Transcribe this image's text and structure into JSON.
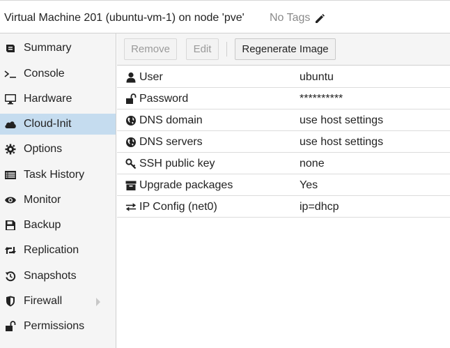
{
  "header": {
    "title": "Virtual Machine 201 (ubuntu-vm-1) on node 'pve'",
    "tags": "No Tags"
  },
  "sidebar": {
    "items": [
      {
        "label": "Summary",
        "icon": "summary-icon"
      },
      {
        "label": "Console",
        "icon": "console-icon"
      },
      {
        "label": "Hardware",
        "icon": "monitor-icon"
      },
      {
        "label": "Cloud-Init",
        "icon": "cloud-icon",
        "active": true
      },
      {
        "label": "Options",
        "icon": "gear-icon"
      },
      {
        "label": "Task History",
        "icon": "list-icon"
      },
      {
        "label": "Monitor",
        "icon": "eye-icon"
      },
      {
        "label": "Backup",
        "icon": "floppy-icon"
      },
      {
        "label": "Replication",
        "icon": "retweet-icon"
      },
      {
        "label": "Snapshots",
        "icon": "history-icon"
      },
      {
        "label": "Firewall",
        "icon": "shield-icon",
        "expandable": true
      },
      {
        "label": "Permissions",
        "icon": "unlock-icon"
      }
    ]
  },
  "toolbar": {
    "remove_label": "Remove",
    "edit_label": "Edit",
    "regenerate_label": "Regenerate Image"
  },
  "settings": [
    {
      "key": "User",
      "value": "ubuntu",
      "icon": "user-icon"
    },
    {
      "key": "Password",
      "value": "**********",
      "icon": "unlock-icon"
    },
    {
      "key": "DNS domain",
      "value": "use host settings",
      "icon": "globe-icon"
    },
    {
      "key": "DNS servers",
      "value": "use host settings",
      "icon": "globe-icon"
    },
    {
      "key": "SSH public key",
      "value": "none",
      "icon": "key-icon"
    },
    {
      "key": "Upgrade packages",
      "value": "Yes",
      "icon": "archive-icon"
    },
    {
      "key": "IP Config (net0)",
      "value": "ip=dhcp",
      "icon": "exchange-icon"
    }
  ],
  "colors": {
    "active_bg": "#c5dcef",
    "sidebar_bg": "#f5f5f5"
  }
}
